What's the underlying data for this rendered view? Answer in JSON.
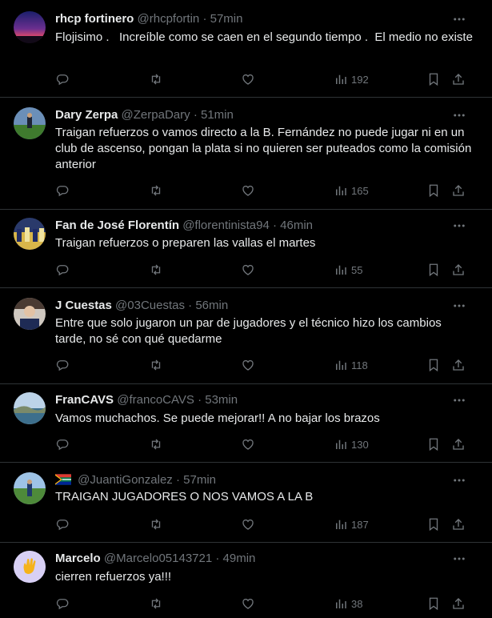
{
  "tweets": [
    {
      "name": "rhcp fortinero",
      "handle": "@rhcpfortin",
      "time": "57min",
      "text": "Flojisimo .   Increíble como se caen en el segundo tiempo .  El medio no existe",
      "views": "192"
    },
    {
      "name": "Dary Zerpa",
      "handle": "@ZerpaDary",
      "time": "51min",
      "text": "Traigan refuerzos o vamos directo a la B. Fernández no puede jugar ni en un club de ascenso, pongan la plata si no quieren ser puteados como la comisión anterior",
      "views": "165"
    },
    {
      "name": "Fan de José Florentín",
      "handle": "@florentinista94",
      "time": "46min",
      "text": "Traigan refuerzos o preparen las vallas el martes",
      "views": "55"
    },
    {
      "name": "J Cuestas",
      "handle": "@03Cuestas",
      "time": "56min",
      "text": "Entre que solo jugaron un par de jugadores y el técnico hizo los cambios tarde, no sé con qué quedarme",
      "views": "118"
    },
    {
      "name": "FranCAVS",
      "handle": "@francoCAVS",
      "time": "53min",
      "text": "Vamos muchachos. Se puede mejorar!! A no bajar los brazos",
      "views": "130"
    },
    {
      "name": "",
      "handle": "@JuantiGonzalez",
      "time": "57min",
      "text": "TRAIGAN JUGADORES O NOS VAMOS A LA B",
      "views": "187"
    },
    {
      "name": "Marcelo",
      "handle": "@Marcelo05143721",
      "time": "49min",
      "text": "cierren refuerzos ya!!!",
      "views": "38"
    }
  ],
  "separator": "·",
  "icons": {
    "reply": "reply-icon",
    "retweet": "retweet-icon",
    "like": "like-icon",
    "views": "views-icon",
    "bookmark": "bookmark-icon",
    "share": "share-icon",
    "more": "more-icon",
    "flag": "south-africa-flag-icon",
    "wave": "waving-hand-emoji"
  },
  "colors": {
    "background": "#000000",
    "text": "#e7e9ea",
    "muted": "#71767b",
    "border": "#2f3336",
    "marcelo_avatar_bg": "#d8d0f5"
  }
}
